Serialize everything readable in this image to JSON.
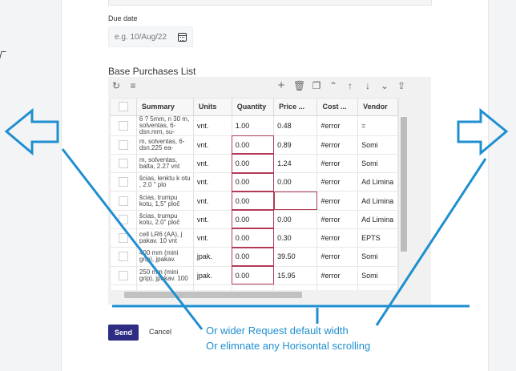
{
  "form": {
    "due_date_label": "Due date",
    "due_date_placeholder": "e.g. 10/Aug/22",
    "list_title": "Base Purchases List",
    "send_label": "Send",
    "cancel_label": "Cancel"
  },
  "toolbar": {
    "icons": [
      "refresh-icon",
      "filter-icon",
      "add-icon",
      "delete-icon",
      "copy-icon",
      "move-top-icon",
      "move-up-icon",
      "move-down-icon",
      "move-bottom-icon",
      "upload-icon"
    ]
  },
  "table": {
    "headers": [
      "Summary",
      "Units",
      "Quantity",
      "Price ...",
      "Cost ...",
      "Vendor"
    ],
    "rows": [
      {
        "summary": "6 ? 5mm, n 30 m, solventas, 6-dsn.mm, su-",
        "units": "vnt.",
        "quantity": "1.00",
        "price": "0.48",
        "cost": "#error",
        "vendor": "="
      },
      {
        "summary": "m, solventas, 6-dsn.225 ea-",
        "units": "vnt.",
        "quantity": "0.00",
        "price": "0.89",
        "cost": "#error",
        "vendor": "Somi"
      },
      {
        "summary": "m, solventas, balta, 2.27 vnt",
        "units": "vnt.",
        "quantity": "0.00",
        "price": "1.24",
        "cost": "#error",
        "vendor": "Somi"
      },
      {
        "summary": "šcias, lenktu k otu , 2.0 \" plo",
        "units": "vnt.",
        "quantity": "0.00",
        "price": "0.00",
        "cost": "#error",
        "vendor": "Ad Limina"
      },
      {
        "summary": "šcias, trumpu kotu, 1,5\" ploč",
        "units": "vnt.",
        "quantity": "0.00",
        "price": "",
        "cost": "#error",
        "vendor": "Ad Limina"
      },
      {
        "summary": "šcias, trumpu kotu, 2.0\" ploč",
        "units": "vnt.",
        "quantity": "0.00",
        "price": "0.00",
        "cost": "#error",
        "vendor": "Ad Limina"
      },
      {
        "summary": "cell LR6 (AA), j pakav. 10 vnt",
        "units": "vnt.",
        "quantity": "0.00",
        "price": "0.30",
        "cost": "#error",
        "vendor": "EPTS"
      },
      {
        "summary": "400 mm (mini grip), jpakav.",
        "units": "jpak.",
        "quantity": "0.00",
        "price": "39.50",
        "cost": "#error",
        "vendor": "Somi"
      },
      {
        "summary": "250 mm (mini grip), jpakav. 100",
        "units": "jpak.",
        "quantity": "0.00",
        "price": "15.95",
        "cost": "#error",
        "vendor": "Somi"
      },
      {
        "summary": "",
        "units": "",
        "quantity": "",
        "price": "",
        "cost": "",
        "vendor": ""
      }
    ]
  },
  "annotation": {
    "line1": "Or wider Request default width",
    "line2": "Or elimnate any Horisontal scrolling",
    "color": "#1f8fd0"
  },
  "colors": {
    "primary_button": "#2d2e83",
    "error_outline": "#b33a56"
  }
}
